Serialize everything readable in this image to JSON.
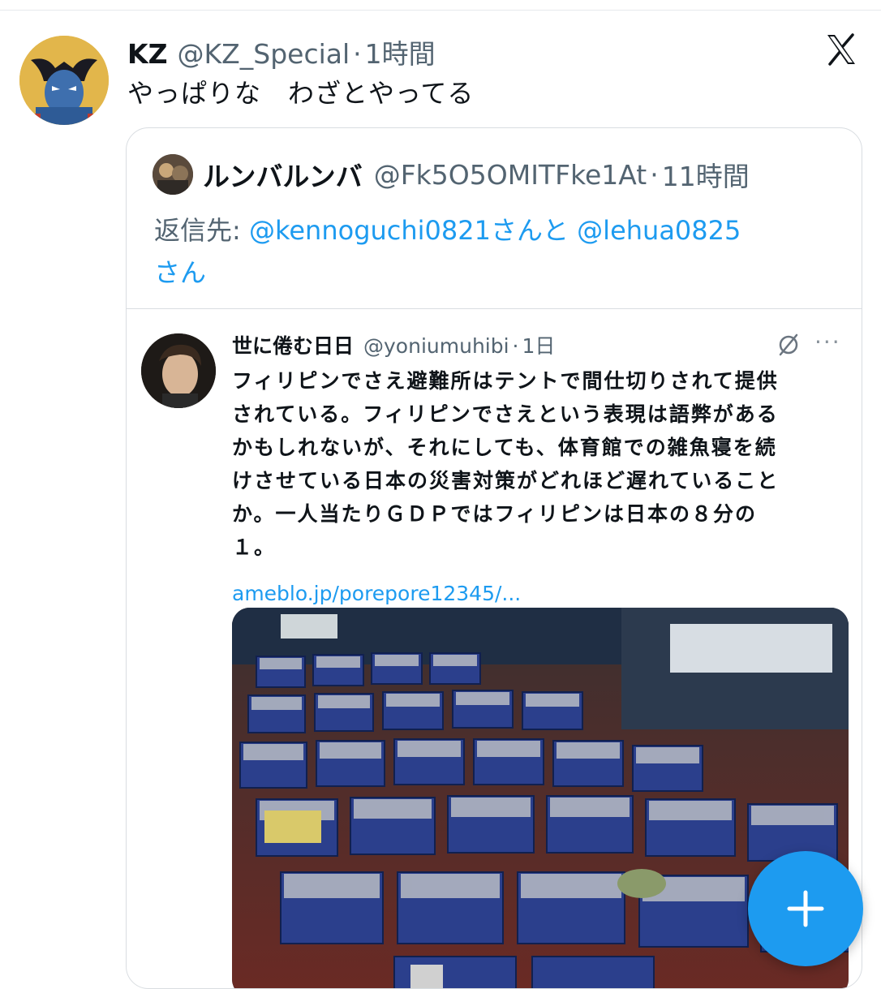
{
  "tweet": {
    "author_name": "KZ",
    "author_handle": "@KZ_Special",
    "separator": "·",
    "time": "1時間",
    "text": "やっぱりな　わざとやってる"
  },
  "quote": {
    "author_name": "ルンバルンバ",
    "author_handle": "@Fk5O5OMITFke1At",
    "separator": "·",
    "time": "11時間",
    "reply_prefix": "返信先: ",
    "mention_1": "@kennoguchi0821",
    "joiner": "さんと",
    "mention_2": "@lehua0825",
    "suffix": "さん"
  },
  "embedded": {
    "author_name": "世に倦む日日",
    "author_handle": "@yoniumuhibi",
    "separator": "·",
    "time": "1日",
    "more": "···",
    "text_lines": [
      "フィリピンでさえ避難所はテントで間仕切りされて提供",
      "されている。フィリピンでさえという表現は語弊がある",
      "かもしれないが、それにしても、体育館での雑魚寝を続",
      "けさせている日本の災害対策がどれほど遅れていること",
      "か。一人当たりＧＤＰではフィリピンは日本の８分の",
      "１。"
    ],
    "link": "ameblo.jp/porepore12345/..."
  },
  "icons": {
    "x_logo": "x-logo-icon",
    "grok": "grok-icon",
    "compose": "plus-icon"
  },
  "colors": {
    "accent": "#1d9bf0",
    "secondary_text": "#536471",
    "primary_text": "#0f1419",
    "border": "#d9dde1"
  }
}
